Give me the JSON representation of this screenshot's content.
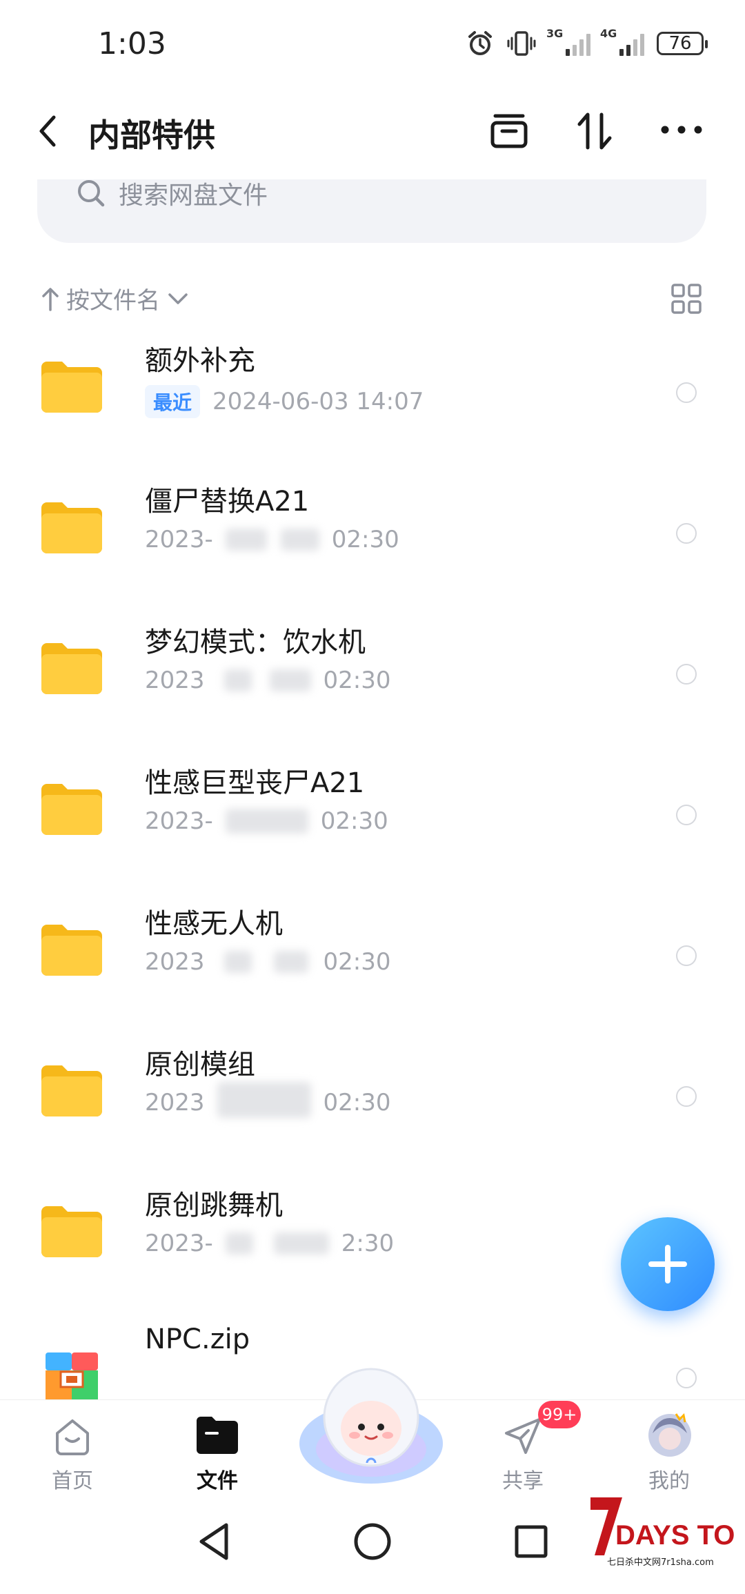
{
  "status_bar": {
    "time": "1:03",
    "battery": "76",
    "net1": "3G",
    "net2": "4G"
  },
  "header": {
    "title": "内部特供"
  },
  "search": {
    "placeholder": "搜索网盘文件"
  },
  "sort": {
    "label": "按文件名"
  },
  "files": [
    {
      "name": "额外补充",
      "badge": "最近",
      "date": "2024-06-03  14:07"
    },
    {
      "name": "僵尸替换A21",
      "date_start": "2023-",
      "date_end": "02:30"
    },
    {
      "name": "梦幻模式：饮水机",
      "date_start": "2023",
      "date_end": "02:30"
    },
    {
      "name": "性感巨型丧尸A21",
      "date_start": "2023-",
      "date_end": "02:30"
    },
    {
      "name": "性感无人机",
      "date_start": "2023",
      "date_end": "02:30"
    },
    {
      "name": "原创模组",
      "date_start": "2023",
      "date_end": "02:30"
    },
    {
      "name": "原创跳舞机",
      "date_start": "2023-",
      "date_end": "2:30"
    },
    {
      "name": "NPC.zip"
    }
  ],
  "bottom_nav": {
    "home": "首页",
    "files": "文件",
    "share": "共享",
    "share_badge": "99+",
    "me": "我的"
  },
  "watermark": {
    "line1": "DAYS TO DIE",
    "line2": "七日杀中文网7r1sha.com"
  },
  "colors": {
    "accent": "#2f8cff",
    "folder": "#ffc93a",
    "badge_red": "#ff3d57"
  }
}
